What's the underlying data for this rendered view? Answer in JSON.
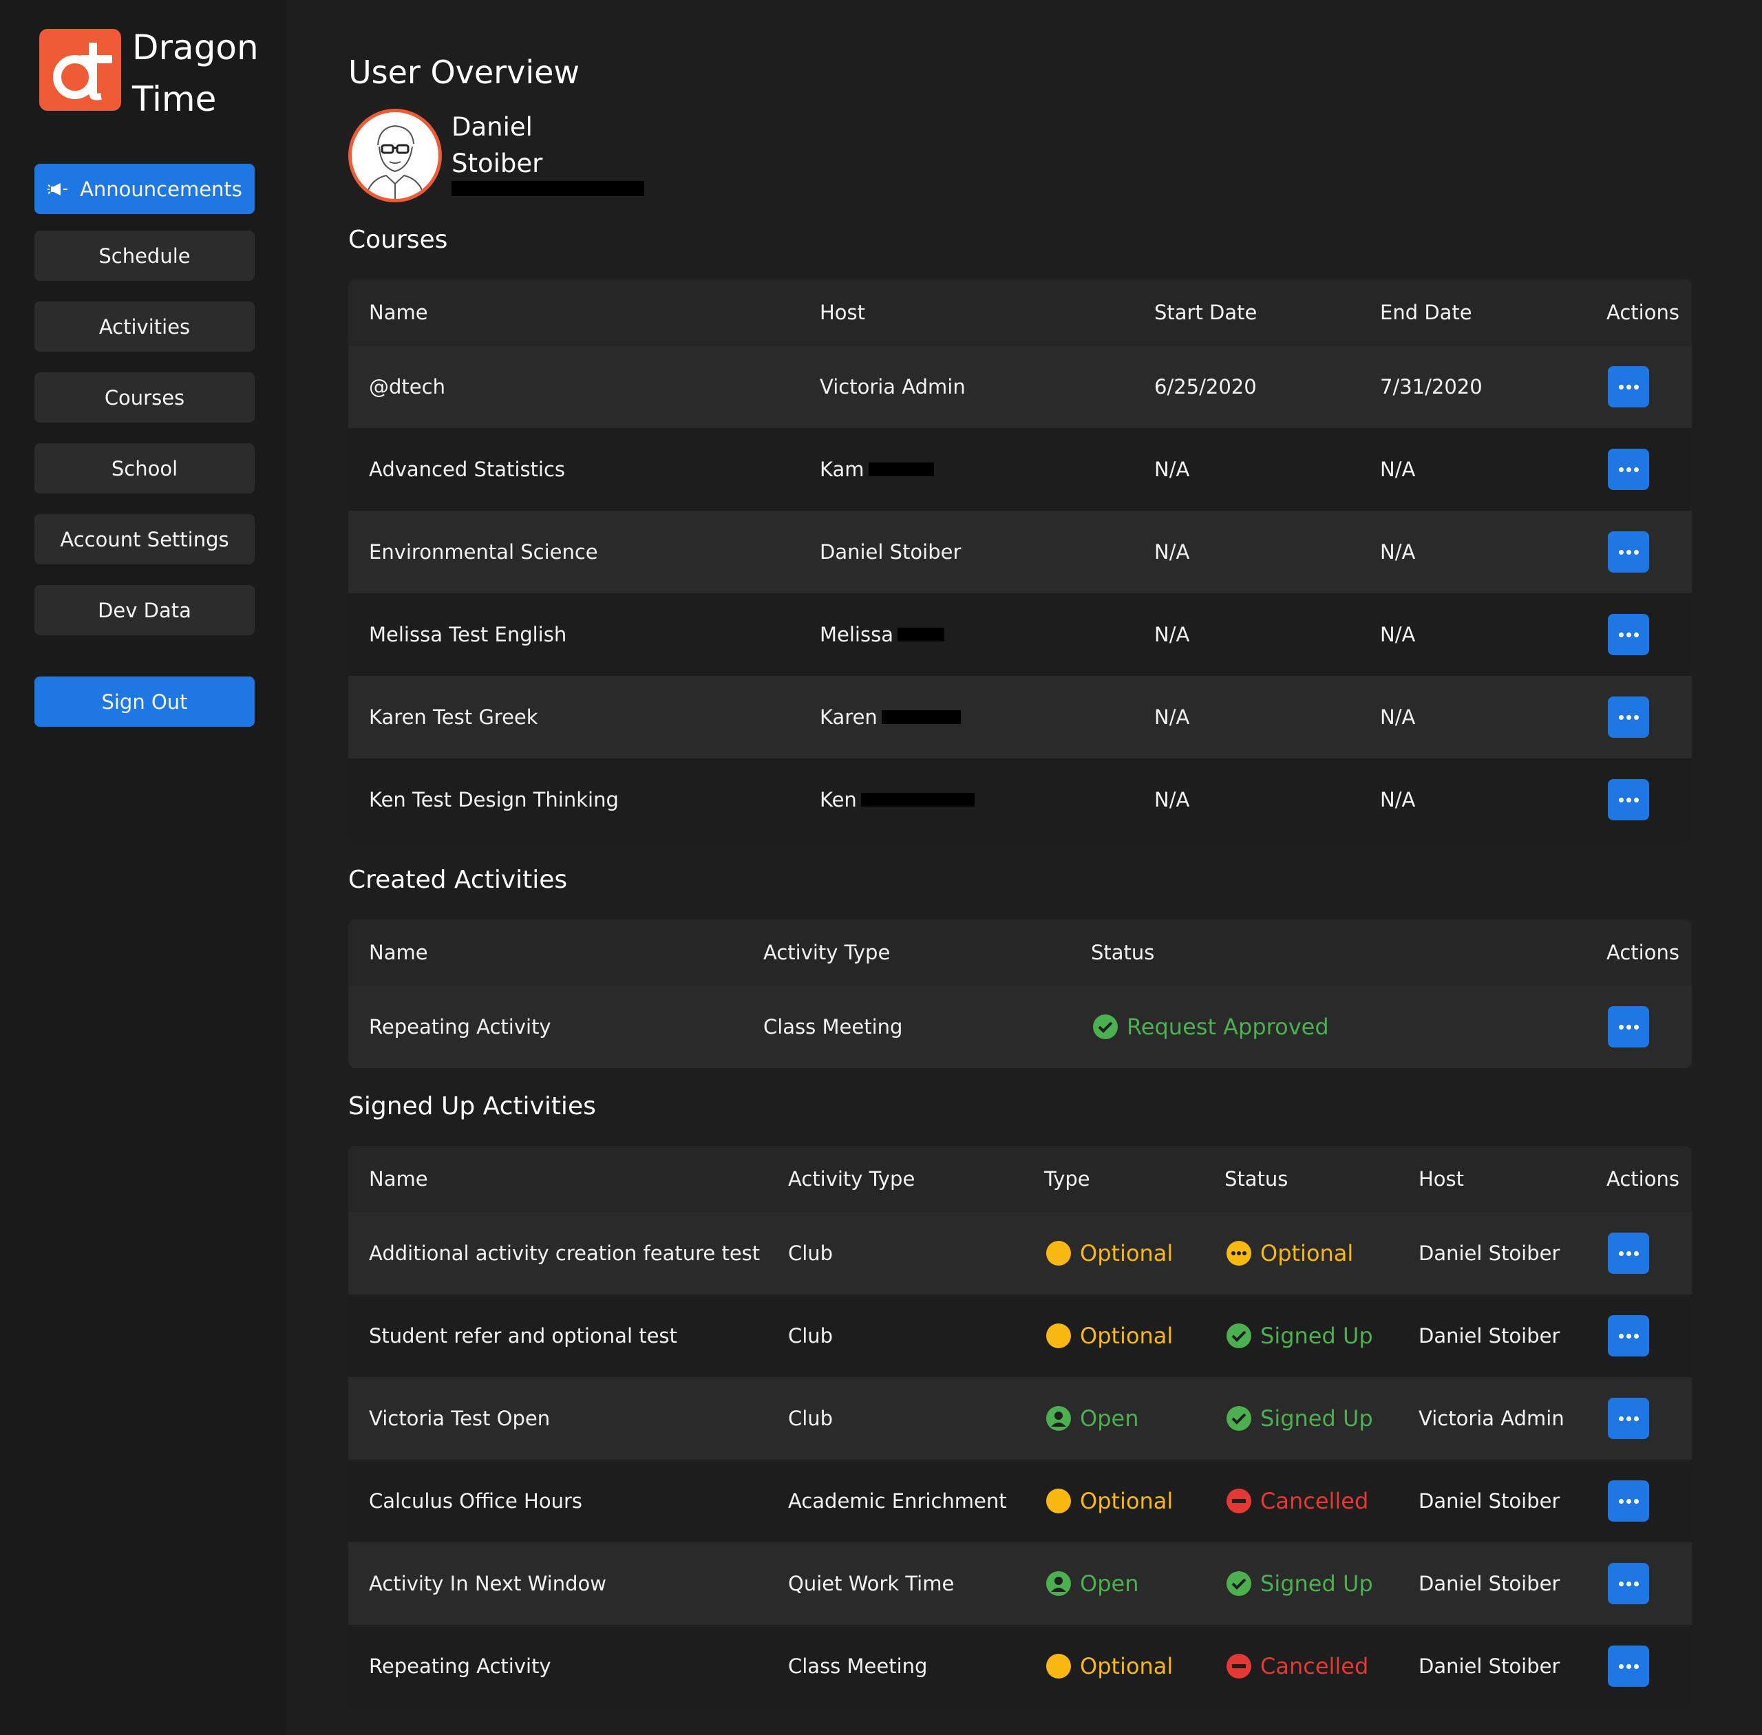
{
  "brand": {
    "line1": "Dragon",
    "line2": "Time",
    "color": "#ef5b34"
  },
  "nav": {
    "announcements": "Announcements",
    "schedule": "Schedule",
    "activities": "Activities",
    "courses": "Courses",
    "school": "School",
    "account_settings": "Account Settings",
    "dev_data": "Dev Data",
    "sign_out": "Sign Out"
  },
  "page": {
    "title": "User Overview",
    "user_first": "Daniel",
    "user_last": "Stoiber"
  },
  "courses": {
    "title": "Courses",
    "headers": {
      "name": "Name",
      "host": "Host",
      "start": "Start Date",
      "end": "End Date",
      "actions": "Actions"
    },
    "rows": [
      {
        "name": "@dtech",
        "host": "Victoria Admin",
        "start": "6/25/2020",
        "end": "7/31/2020"
      },
      {
        "name": "Advanced Statistics",
        "host": "Kam",
        "start": "N/A",
        "end": "N/A"
      },
      {
        "name": "Environmental Science",
        "host": "Daniel Stoiber",
        "start": "N/A",
        "end": "N/A"
      },
      {
        "name": "Melissa Test English",
        "host": "Melissa",
        "start": "N/A",
        "end": "N/A"
      },
      {
        "name": "Karen Test Greek",
        "host": "Karen",
        "start": "N/A",
        "end": "N/A"
      },
      {
        "name": "Ken Test Design Thinking",
        "host": "Ken",
        "start": "N/A",
        "end": "N/A"
      }
    ]
  },
  "created": {
    "title": "Created Activities",
    "headers": {
      "name": "Name",
      "type": "Activity Type",
      "status": "Status",
      "actions": "Actions"
    },
    "rows": [
      {
        "name": "Repeating Activity",
        "type": "Class Meeting",
        "status": "Request Approved"
      }
    ]
  },
  "signed": {
    "title": "Signed Up Activities",
    "headers": {
      "name": "Name",
      "activity_type": "Activity Type",
      "type": "Type",
      "status": "Status",
      "host": "Host",
      "actions": "Actions"
    },
    "rows": [
      {
        "name": "Additional activity creation feature test",
        "activity_type": "Club",
        "type": "Optional",
        "status": "Optional",
        "host": "Daniel Stoiber"
      },
      {
        "name": "Student refer and optional test",
        "activity_type": "Club",
        "type": "Optional",
        "status": "Signed Up",
        "host": "Daniel Stoiber"
      },
      {
        "name": "Victoria Test Open",
        "activity_type": "Club",
        "type": "Open",
        "status": "Signed Up",
        "host": "Victoria Admin"
      },
      {
        "name": "Calculus Office Hours",
        "activity_type": "Academic Enrichment",
        "type": "Optional",
        "status": "Cancelled",
        "host": "Daniel Stoiber"
      },
      {
        "name": "Activity In Next Window",
        "activity_type": "Quiet Work Time",
        "type": "Open",
        "status": "Signed Up",
        "host": "Daniel Stoiber"
      },
      {
        "name": "Repeating Activity",
        "activity_type": "Class Meeting",
        "type": "Optional",
        "status": "Cancelled",
        "host": "Daniel Stoiber"
      }
    ]
  },
  "colors": {
    "accent": "#1e77e3",
    "green": "#4caf50",
    "yellow": "#f9b912",
    "red": "#e53935"
  }
}
